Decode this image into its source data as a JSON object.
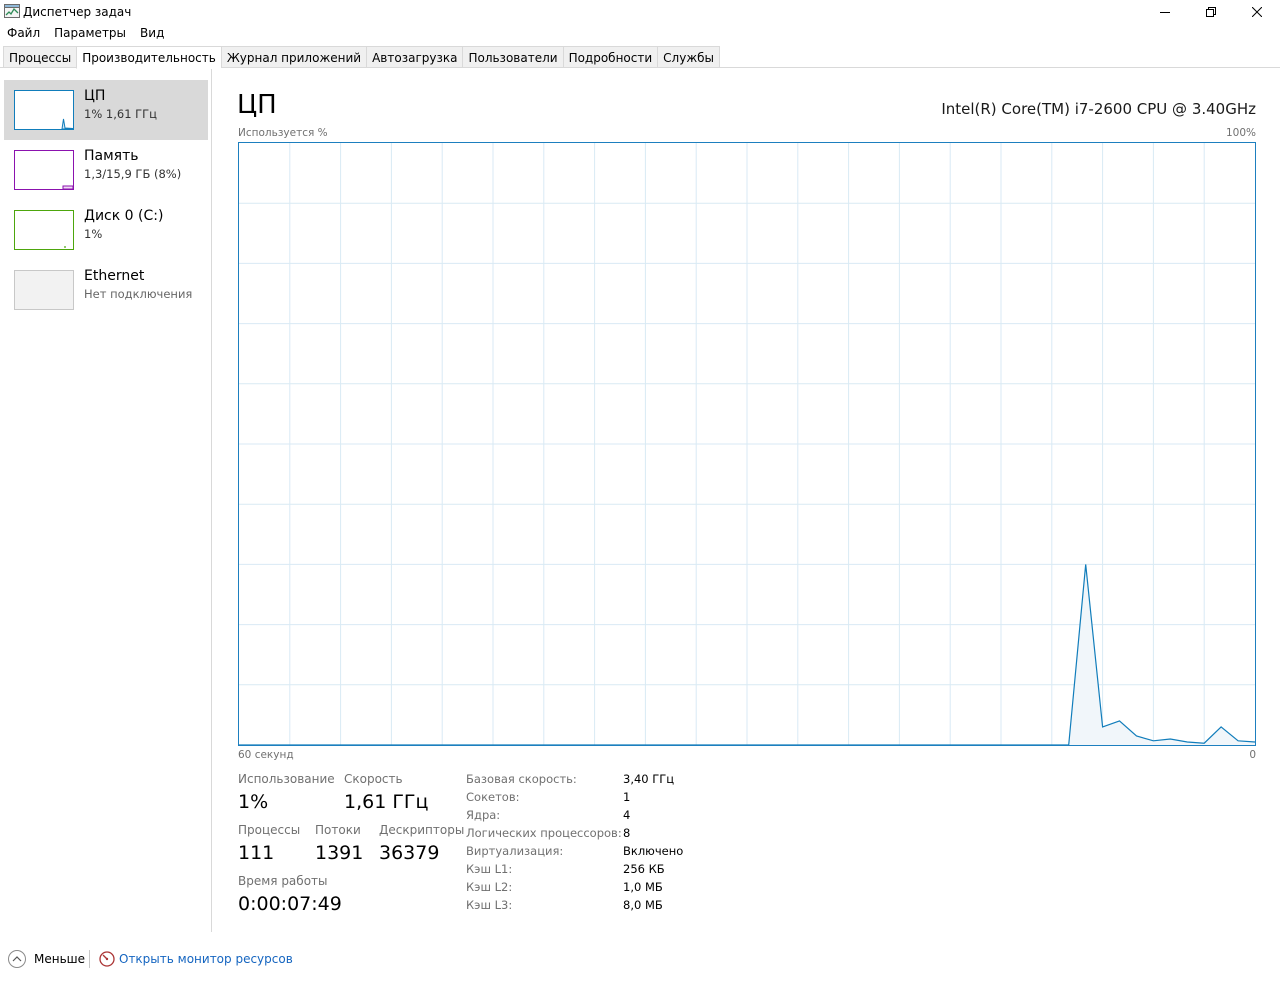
{
  "window": {
    "title": "Диспетчер задач"
  },
  "menu": [
    "Файл",
    "Параметры",
    "Вид"
  ],
  "tabs": [
    {
      "label": "Процессы",
      "active": false
    },
    {
      "label": "Производительность",
      "active": true
    },
    {
      "label": "Журнал приложений",
      "active": false
    },
    {
      "label": "Автозагрузка",
      "active": false
    },
    {
      "label": "Пользователи",
      "active": false
    },
    {
      "label": "Подробности",
      "active": false
    },
    {
      "label": "Службы",
      "active": false
    }
  ],
  "sidebar": {
    "items": [
      {
        "title": "ЦП",
        "subtitle": "1%  1,61 ГГц",
        "color": "#117dbb",
        "selected": true
      },
      {
        "title": "Память",
        "subtitle": "1,3/15,9 ГБ (8%)",
        "color": "#8b12ae",
        "selected": false
      },
      {
        "title": "Диск 0 (C:)",
        "subtitle": "1%",
        "color": "#4da60c",
        "selected": false
      },
      {
        "title": "Ethernet",
        "subtitle": "Нет подключения",
        "color": "#a7a7a7",
        "selected": false
      }
    ]
  },
  "main": {
    "title": "ЦП",
    "cpu_model": "Intel(R) Core(TM) i7-2600 CPU @ 3.40GHz",
    "y_label": "Используется %",
    "y_max_label": "100%",
    "x_left_label": "60 секунд",
    "x_right_label": "0"
  },
  "chart_data": {
    "type": "area",
    "x_label": "60 секунд",
    "y_label": "Используется %",
    "ylim": [
      0,
      100
    ],
    "xlim": [
      60,
      0
    ],
    "grid": true,
    "color": "#117dbb",
    "fill": "#f1f6fa",
    "series": [
      {
        "x": [
          60,
          59,
          58,
          57,
          56,
          55,
          54,
          53,
          52,
          51,
          50,
          49,
          48,
          47,
          46,
          45,
          44,
          43,
          42,
          41,
          40,
          39,
          38,
          37,
          36,
          35,
          34,
          33,
          32,
          31,
          30,
          29,
          28,
          27,
          26,
          25,
          24,
          23,
          22,
          21,
          20,
          19,
          18,
          17,
          16,
          15,
          14,
          13,
          12,
          11,
          10,
          9,
          8,
          7,
          6,
          5,
          4,
          3,
          2,
          1,
          0
        ],
        "values": [
          0,
          0,
          0,
          0,
          0,
          0,
          0,
          0,
          0,
          0,
          0,
          0,
          0,
          0,
          0,
          0,
          0,
          0,
          0,
          0,
          0,
          0,
          0,
          0,
          0,
          0,
          0,
          0,
          0,
          0,
          0,
          0,
          0,
          0,
          0,
          0,
          0,
          0,
          0,
          0,
          0,
          0,
          0,
          0,
          0,
          0,
          0,
          0,
          0,
          0,
          30,
          3,
          4,
          1.5,
          0.7,
          1,
          0.5,
          0.3,
          3,
          0.7,
          0.5
        ]
      }
    ]
  },
  "stats": {
    "usage_label": "Использование",
    "usage_value": "1%",
    "speed_label": "Скорость",
    "speed_value": "1,61 ГГц",
    "processes_label": "Процессы",
    "processes_value": "111",
    "threads_label": "Потоки",
    "threads_value": "1391",
    "handles_label": "Дескрипторы",
    "handles_value": "36379",
    "uptime_label": "Время работы",
    "uptime_value": "0:00:07:49"
  },
  "details": [
    {
      "key": "Базовая скорость:",
      "value": "3,40 ГГц"
    },
    {
      "key": "Сокетов:",
      "value": "1"
    },
    {
      "key": "Ядра:",
      "value": "4"
    },
    {
      "key": "Логических процессоров:",
      "value": "8"
    },
    {
      "key": "Виртуализация:",
      "value": "Включено"
    },
    {
      "key": "Кэш L1:",
      "value": "256 КБ"
    },
    {
      "key": "Кэш L2:",
      "value": "1,0 МБ"
    },
    {
      "key": "Кэш L3:",
      "value": "8,0 МБ"
    }
  ],
  "footer": {
    "fewer_label": "Меньше",
    "resource_monitor_label": "Открыть монитор ресурсов"
  }
}
